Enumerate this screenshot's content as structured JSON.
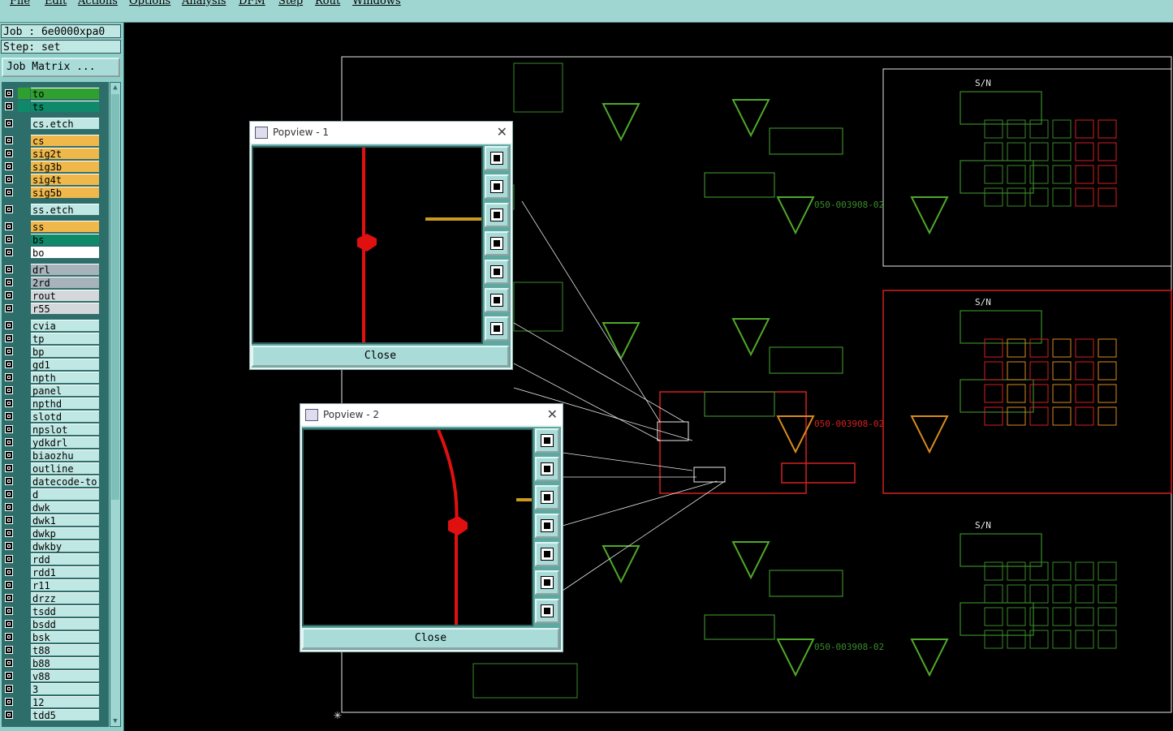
{
  "menu": [
    "File",
    "Edit",
    "Actions",
    "Options",
    "Analysis",
    "DFM",
    "Step",
    "Rout",
    "Windows"
  ],
  "job": {
    "job_label": "Job : 6e0000xpa0",
    "step_label": "Step: set",
    "matrix_button": "Job Matrix ..."
  },
  "layers": [
    {
      "name": "to",
      "color": "#2fa02f"
    },
    {
      "name": "ts",
      "color": "#0e8a6a"
    },
    {
      "name": "cs.etch",
      "color": "#bfe7e3"
    },
    {
      "name": "cs",
      "color": "#f0b84a"
    },
    {
      "name": "sig2t",
      "color": "#f0b84a"
    },
    {
      "name": "sig3b",
      "color": "#f0b84a"
    },
    {
      "name": "sig4t",
      "color": "#f0b84a"
    },
    {
      "name": "sig5b",
      "color": "#f0b84a"
    },
    {
      "name": "ss.etch",
      "color": "#bfe7e3"
    },
    {
      "name": "ss",
      "color": "#f0b84a"
    },
    {
      "name": "bs",
      "color": "#0e8a6a"
    },
    {
      "name": "bo",
      "color": "#ffffff"
    },
    {
      "name": "drl",
      "color": "#a7b3bb"
    },
    {
      "name": "2rd",
      "color": "#a7b3bb"
    },
    {
      "name": "rout",
      "color": "#d4d8da"
    },
    {
      "name": "r55",
      "color": "#d4d8da"
    },
    {
      "name": "cvia",
      "color": "#bfe7e3"
    },
    {
      "name": "tp",
      "color": "#bfe7e3"
    },
    {
      "name": "bp",
      "color": "#bfe7e3"
    },
    {
      "name": "gd1",
      "color": "#bfe7e3"
    },
    {
      "name": "npth",
      "color": "#bfe7e3"
    },
    {
      "name": "panel",
      "color": "#bfe7e3"
    },
    {
      "name": "npthd",
      "color": "#bfe7e3"
    },
    {
      "name": "slotd",
      "color": "#bfe7e3"
    },
    {
      "name": "npslot",
      "color": "#bfe7e3"
    },
    {
      "name": "ydkdrl",
      "color": "#bfe7e3"
    },
    {
      "name": "biaozhu",
      "color": "#bfe7e3"
    },
    {
      "name": "outline",
      "color": "#bfe7e3"
    },
    {
      "name": "datecode-to",
      "color": "#bfe7e3"
    },
    {
      "name": "d",
      "color": "#bfe7e3"
    },
    {
      "name": "dwk",
      "color": "#bfe7e3"
    },
    {
      "name": "dwk1",
      "color": "#bfe7e3"
    },
    {
      "name": "dwkp",
      "color": "#bfe7e3"
    },
    {
      "name": "dwkby",
      "color": "#bfe7e3"
    },
    {
      "name": "rdd",
      "color": "#bfe7e3"
    },
    {
      "name": "rdd1",
      "color": "#bfe7e3"
    },
    {
      "name": "r11",
      "color": "#bfe7e3"
    },
    {
      "name": "drzz",
      "color": "#bfe7e3"
    },
    {
      "name": "tsdd",
      "color": "#bfe7e3"
    },
    {
      "name": "bsdd",
      "color": "#bfe7e3"
    },
    {
      "name": "bsk",
      "color": "#bfe7e3"
    },
    {
      "name": "t88",
      "color": "#bfe7e3"
    },
    {
      "name": "b88",
      "color": "#bfe7e3"
    },
    {
      "name": "v88",
      "color": "#bfe7e3"
    },
    {
      "name": "3",
      "color": "#bfe7e3"
    },
    {
      "name": "12",
      "color": "#bfe7e3"
    },
    {
      "name": "tdd5",
      "color": "#bfe7e3"
    }
  ],
  "popviews": [
    {
      "title": "Popview - 1",
      "close": "Close"
    },
    {
      "title": "Popview - 2",
      "close": "Close"
    }
  ],
  "board": {
    "part_label": "050-003908-02",
    "sn_label": "S/N",
    "colors": {
      "green": "#3a8a2a",
      "bright_green": "#4fa82a",
      "red": "#d42020",
      "orange": "#d68a20",
      "white": "#e8e8e8"
    }
  }
}
